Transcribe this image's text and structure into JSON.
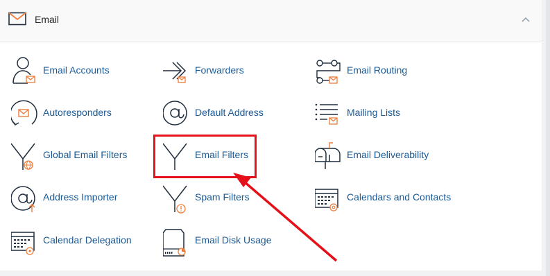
{
  "header": {
    "title": "Email",
    "envelope_icon": "envelope-icon",
    "collapse_icon": "chevron-up-icon"
  },
  "colors": {
    "link": "#1a5a96",
    "icon_stroke": "#1f2d3d",
    "icon_accent": "#ee7d3b",
    "annotation": "#e4101a"
  },
  "tools": [
    {
      "label": "Email Accounts",
      "icon": "user-envelope-icon"
    },
    {
      "label": "Forwarders",
      "icon": "forward-arrow-icon"
    },
    {
      "label": "Email Routing",
      "icon": "routing-icon"
    },
    {
      "label": "Autoresponders",
      "icon": "autoresponder-icon"
    },
    {
      "label": "Default Address",
      "icon": "at-sign-icon"
    },
    {
      "label": "Mailing Lists",
      "icon": "list-envelope-icon"
    },
    {
      "label": "Global Email Filters",
      "icon": "funnel-globe-icon"
    },
    {
      "label": "Email Filters",
      "icon": "funnel-icon"
    },
    {
      "label": "Email Deliverability",
      "icon": "mailbox-icon"
    },
    {
      "label": "Address Importer",
      "icon": "at-upload-icon"
    },
    {
      "label": "Spam Filters",
      "icon": "funnel-warning-icon"
    },
    {
      "label": "Calendars and Contacts",
      "icon": "calendar-at-icon"
    },
    {
      "label": "Calendar Delegation",
      "icon": "calendar-delegate-icon"
    },
    {
      "label": "Email Disk Usage",
      "icon": "disk-usage-icon"
    }
  ],
  "annotation": {
    "highlighted_item": "Email Filters"
  }
}
